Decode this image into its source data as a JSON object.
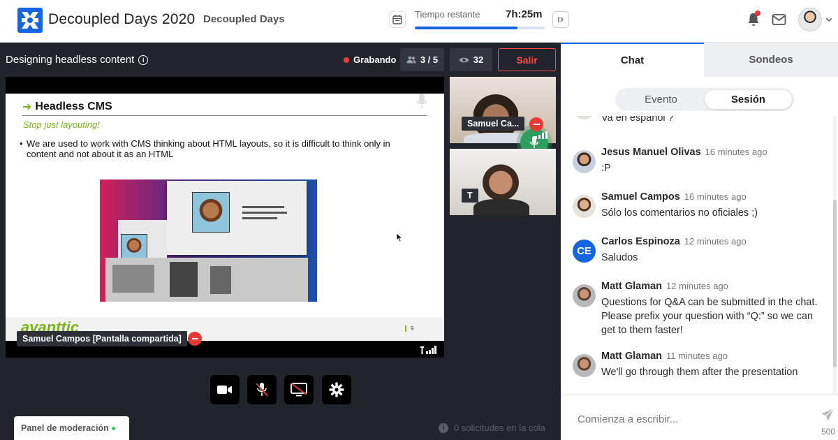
{
  "header": {
    "app_title": "Decoupled Days 2020",
    "event_name": "Decoupled Days",
    "time_label": "Tiempo restante",
    "time_value": "7h:25m",
    "time_progress_percent": 79
  },
  "stage": {
    "session_title": "Designing headless content",
    "recording_label": "Grabando",
    "participants_count": "3 / 5",
    "viewers_count": "32",
    "exit_label": "Salir",
    "screen_share_label": "Samuel Campos [Pantalla compartida]",
    "slide": {
      "heading": "Headless CMS",
      "subtitle": "Stop just layouting!",
      "bullet": "We are used to work with CMS thinking about HTML layouts, so it is difficult to think only in content and not about it as an HTML",
      "brand": "avanttic",
      "page_number": "9"
    },
    "tiles": [
      {
        "label": "Samuel Ca..."
      },
      {
        "label": "T"
      }
    ],
    "moderation_label": "Panel de moderación",
    "queue_label": "0 solicitudes en la cola"
  },
  "chat": {
    "tabs": [
      "Chat",
      "Sondeos"
    ],
    "segments": [
      "Evento",
      "Sesión"
    ],
    "partial_message": "Va en español ?",
    "messages": [
      {
        "author": "Jesus Manuel Olivas",
        "time": "16 minutes ago",
        "text": ":P"
      },
      {
        "author": "Samuel Campos",
        "time": "16 minutes ago",
        "text": "Sólo los comentarios no oficiales ;)"
      },
      {
        "author": "Carlos Espinoza",
        "time": "12 minutes ago",
        "text": "Saludos",
        "initials": "CE"
      },
      {
        "author": "Matt Glaman",
        "time": "12 minutes ago",
        "text": "Questions for Q&A can be submitted in the chat. Please prefix your question with “Q:” so we can get to them faster!"
      },
      {
        "author": "Matt Glaman",
        "time": "11 minutes ago",
        "text": "We'll go through them after the presentation"
      }
    ],
    "composer_placeholder": "Comienza a escribir...",
    "char_limit": "500"
  },
  "colors": {
    "accent": "#1565e0",
    "stage_bg": "#22242c",
    "danger": "#ff4a4a",
    "brand_green": "#7ab317",
    "active_mic": "#2e9e5e"
  }
}
